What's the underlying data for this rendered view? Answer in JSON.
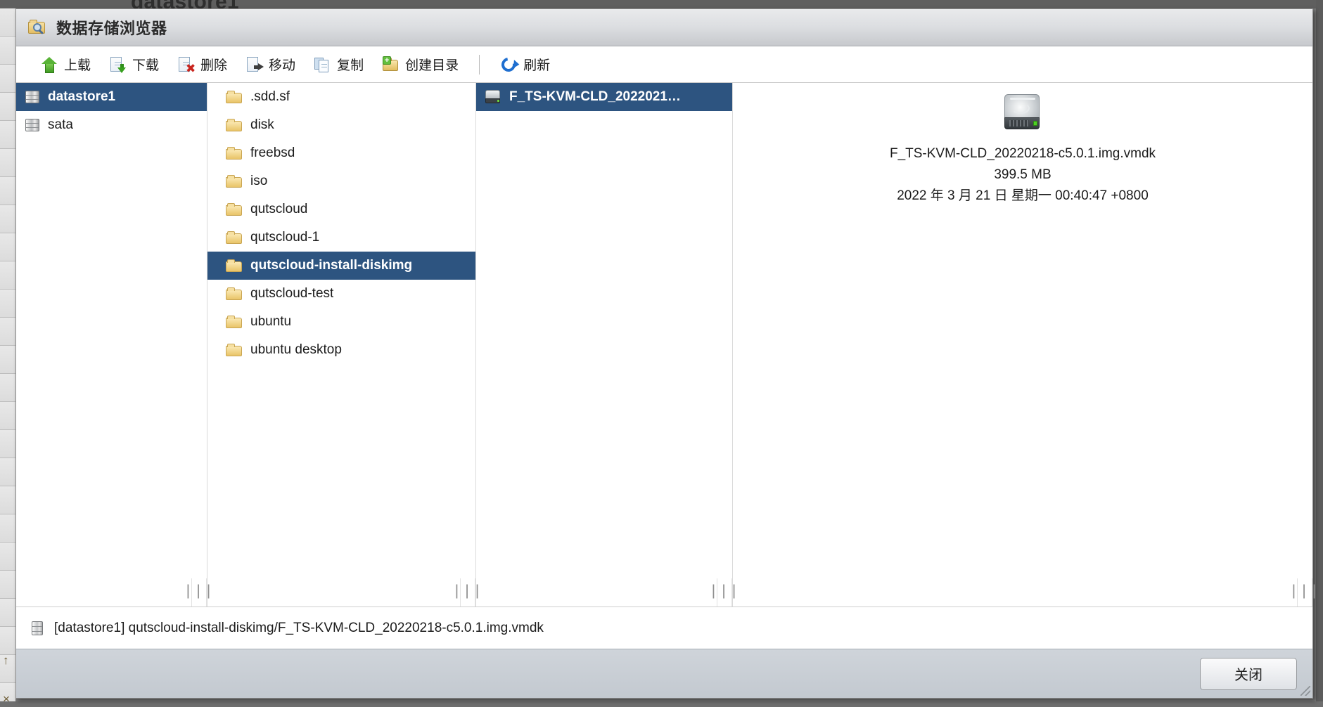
{
  "background": {
    "ghost_title": "datastore1"
  },
  "window": {
    "title": "数据存储浏览器",
    "title_icon": "folder-search-icon"
  },
  "toolbar": {
    "items": [
      {
        "label": "上载",
        "icon": "upload-icon"
      },
      {
        "label": "下载",
        "icon": "download-icon"
      },
      {
        "label": "删除",
        "icon": "delete-icon"
      },
      {
        "label": "移动",
        "icon": "move-icon"
      },
      {
        "label": "复制",
        "icon": "copy-icon"
      },
      {
        "label": "创建目录",
        "icon": "new-folder-icon"
      },
      {
        "label": "刷新",
        "icon": "refresh-icon"
      }
    ]
  },
  "datastores": {
    "items": [
      {
        "label": "datastore1",
        "icon": "datastore-icon",
        "selected": true
      },
      {
        "label": "sata",
        "icon": "datastore-icon",
        "selected": false
      }
    ]
  },
  "folders": {
    "items": [
      {
        "label": ".sdd.sf",
        "icon": "folder-icon",
        "selected": false
      },
      {
        "label": "disk",
        "icon": "folder-icon",
        "selected": false
      },
      {
        "label": "freebsd",
        "icon": "folder-icon",
        "selected": false
      },
      {
        "label": "iso",
        "icon": "folder-icon",
        "selected": false
      },
      {
        "label": "qutscloud",
        "icon": "folder-icon",
        "selected": false
      },
      {
        "label": "qutscloud-1",
        "icon": "folder-icon",
        "selected": false
      },
      {
        "label": "qutscloud-install-diskimg",
        "icon": "folder-icon",
        "selected": true
      },
      {
        "label": "qutscloud-test",
        "icon": "folder-icon",
        "selected": false
      },
      {
        "label": "ubuntu",
        "icon": "folder-icon",
        "selected": false
      },
      {
        "label": "ubuntu desktop",
        "icon": "folder-icon",
        "selected": false
      }
    ]
  },
  "files": {
    "items": [
      {
        "label": "F_TS-KVM-CLD_2022021…",
        "icon": "virtual-disk-icon",
        "selected": true
      }
    ]
  },
  "detail": {
    "icon": "virtual-disk-large-icon",
    "filename": "F_TS-KVM-CLD_20220218-c5.0.1.img.vmdk",
    "size": "399.5 MB",
    "modified": "2022 年 3 月 21 日 星期一 00:40:47 +0800"
  },
  "grips": {
    "glyph": "|||"
  },
  "status": {
    "icon": "datastore-icon",
    "path": "[datastore1] qutscloud-install-diskimg/F_TS-KVM-CLD_20220218-c5.0.1.img.vmdk"
  },
  "footer": {
    "close_label": "关闭"
  },
  "colors": {
    "selection": "#2d5480",
    "titlebar_text": "#2b2b2b",
    "folder_yellow": "#e9c468",
    "refresh_blue": "#1f6fd0",
    "upload_green": "#58b336",
    "delete_red": "#c9241d"
  }
}
